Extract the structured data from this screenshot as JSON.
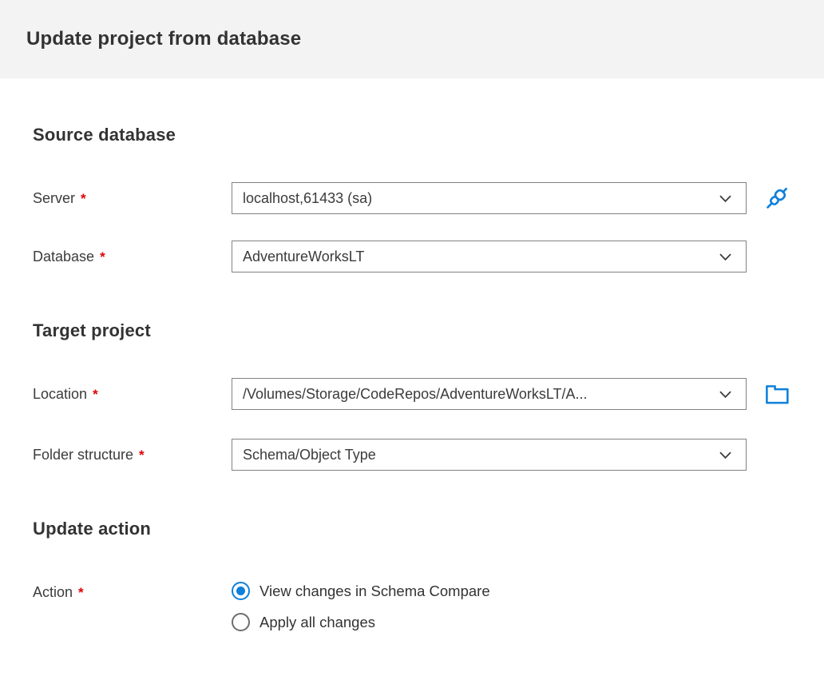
{
  "header": {
    "title": "Update project from database"
  },
  "sections": {
    "source_database": {
      "heading": "Source database",
      "server": {
        "label": "Server",
        "required": "*",
        "value": "localhost,61433 (sa)"
      },
      "database": {
        "label": "Database",
        "required": "*",
        "value": "AdventureWorksLT"
      }
    },
    "target_project": {
      "heading": "Target project",
      "location": {
        "label": "Location",
        "required": "*",
        "value": "/Volumes/Storage/CodeRepos/AdventureWorksLT/A..."
      },
      "folder_structure": {
        "label": "Folder structure",
        "required": "*",
        "value": "Schema/Object Type"
      }
    },
    "update_action": {
      "heading": "Update action",
      "action": {
        "label": "Action",
        "required": "*",
        "options": [
          {
            "label": "View changes in Schema Compare",
            "selected": true
          },
          {
            "label": "Apply all changes",
            "selected": false
          }
        ]
      }
    }
  },
  "icons": {
    "connect": "connect-plug-icon",
    "browse": "folder-icon",
    "dropdown": "chevron-down-icon"
  },
  "colors": {
    "accent_blue": "#0e80db",
    "required_red": "#e00000",
    "header_background": "#f3f3f3",
    "field_border": "#828282",
    "heading_text": "#333333"
  }
}
